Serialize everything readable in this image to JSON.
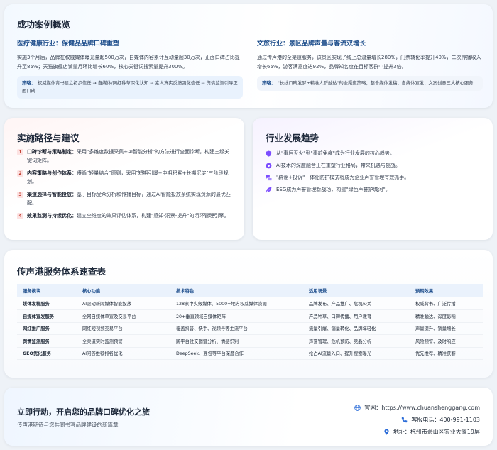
{
  "cases": {
    "title": "成功案例概览",
    "medical": {
      "title": "医疗健康行业：保健品品牌口碑重塑",
      "body": "实施3个月后，品牌在权威媒体曝光量超500万次，自媒体内容累计互动量超30万次，正面口碑占比提升至85%；天猫旗舰店销量月环比增长60%，核心关键词搜索量提升300%。",
      "strategy_label": "策略：",
      "strategy_text": "权威媒体背书建立初步信任 → 自媒体/网红种草深化认知 → 素人真实反馈强化信任 → 舆情监测引导正面口碑"
    },
    "tourism": {
      "title": "文旅行业：景区品牌声量与客流双增长",
      "body": "通过传声港的全渠道服务，该景区实现了线上总流量增长280%，门票转化率提升40%，二次传播收入增长65%，游客满意度达92%，品牌知名度在目标客群中提升3倍。",
      "strategy_label": "策略：",
      "strategy_text": "\"长线口碑发酵+精准人群触达\"的全渠道策略，整合媒体发稿、自媒体宣发、文案创意三大核心服务"
    }
  },
  "roadmap": {
    "title": "实施路径与建议",
    "steps": [
      {
        "num": "1",
        "head": "口碑诊断与策略制定：",
        "text": "采用\"多维度数据采集+AI智能分析\"的方法进行全面诊断，构建三级关键词矩阵。"
      },
      {
        "num": "2",
        "head": "内容策略与创作体系：",
        "text": "遵循\"轻量结合\"原则，采用\"短期引爆+中期积累+长期沉淀\"三阶段规划。"
      },
      {
        "num": "3",
        "head": "渠道选择与智能投放：",
        "text": "基于目标受众分析和传播目标，通过AI智能投放系统实现资源的最优匹配。"
      },
      {
        "num": "4",
        "head": "效果监测与持续优化：",
        "text": "建立全维度的效果评估体系，构建\"感知-洞察-提升\"的闭环管理引擎。"
      }
    ]
  },
  "trends": {
    "title": "行业发展趋势",
    "items": [
      {
        "icon": "shield-icon",
        "color": "#7c4dff",
        "text": "从\"事后灭火\"到\"事前免疫\"成为行业发展的核心趋势。"
      },
      {
        "icon": "ai-chip-icon",
        "color": "#7c4dff",
        "text": "AI技术的深度融合正在重塑行业格局，带来机遇与挑战。"
      },
      {
        "icon": "chat-bubbles-icon",
        "color": "#7c4dff",
        "text": "\"辟谣+投诉\"一体化防护模式将成为企业声誉管理有效抓手。"
      },
      {
        "icon": "leaf-icon",
        "color": "#7c4dff",
        "text": "ESG成为声誉管理新战场，构建\"绿色声誉护城河\"。"
      }
    ]
  },
  "services": {
    "title": "传声港服务体系速查表",
    "headers": [
      "服务模块",
      "核心功能",
      "技术特色",
      "适用场景",
      "预期效果"
    ],
    "rows": [
      [
        "媒体发稿服务",
        "AI驱动新闻媒体智能投放",
        "128家中央级媒体、5000+地方权威媒体资源",
        "品牌发布、产品推广、危机公关",
        "权威背书、广泛传播"
      ],
      [
        "自媒体宣发服务",
        "全网自媒体草宣及交易平台",
        "20+垂直领域自媒体矩阵",
        "产品种草、口碑传播、用户教育",
        "精准触达、深度影响"
      ],
      [
        "网红推广服务",
        "网红短视频交易平台",
        "覆盖抖音、快手、视频号等主流平台",
        "流量引爆、销量转化、品牌年轻化",
        "声量提升、销量增长"
      ],
      [
        "舆情监测服务",
        "全渠道实时监测预警",
        "跨平台社交图谱分析、情感识别",
        "声誉管理、危机预防、竞品分析",
        "风险预警、及时响应"
      ],
      [
        "GEO优化服务",
        "AI问答推荐排名优化",
        "DeepSeek、豆包等平台深度合作",
        "抢占AI流量入口、提升搜索曝光",
        "优先推荐、精准获客"
      ]
    ]
  },
  "cta": {
    "title": "立即行动，开启您的品牌口碑优化之旅",
    "subtitle": "传声港期待与您共同书写品牌建设的新篇章",
    "website": "官网：https://www.chuanshenggang.com",
    "phone": "客服电话：400-991-1103",
    "address": "地址：杭州市萧山区农业大厦19层",
    "accent": "#2b6cd8"
  }
}
